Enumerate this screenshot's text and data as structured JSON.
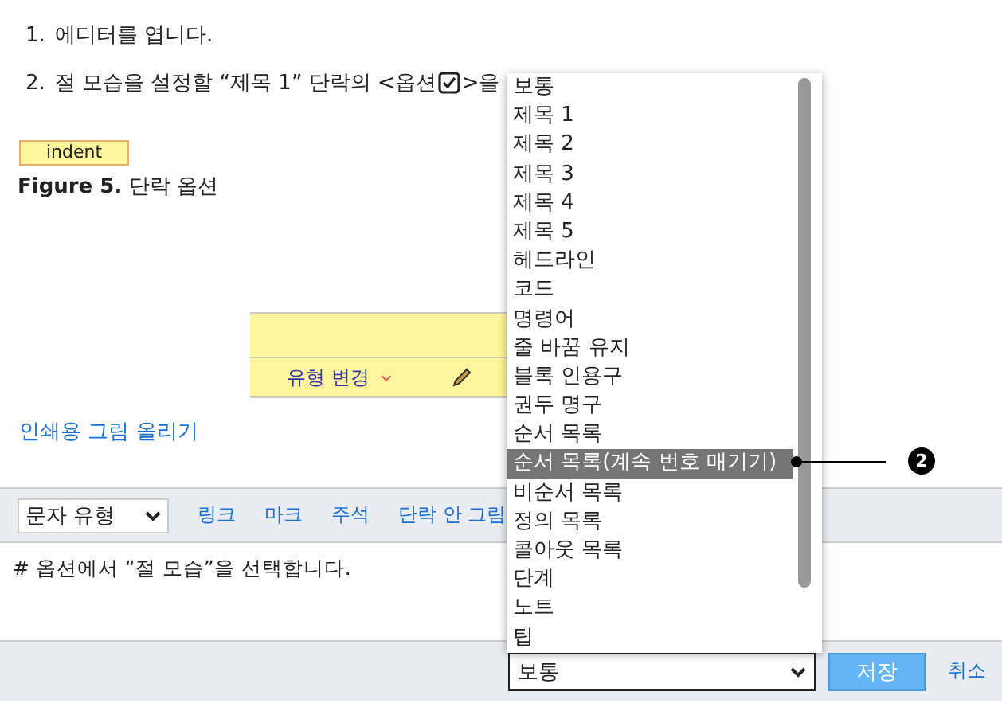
{
  "steps": [
    {
      "number": "1.",
      "text": "에디터를 엽니다."
    },
    {
      "number": "2.",
      "text": "절 모습을 설정할 “제목 1” 단락의 <옵션",
      "after_icon": ">을"
    }
  ],
  "tag": "indent",
  "figure_caption": "**Figure 5.** 단락 옵션",
  "card": {
    "change_type": "유형 변경"
  },
  "upload_link": "인쇄용 그림 올리기",
  "editor": {
    "style_select": "문자 유형",
    "toolbar_links": [
      "링크",
      "마크",
      "주석",
      "단락 안 그림"
    ],
    "text": "# 옵션에서 “절 모습”을 선택합니다.",
    "paragraph_select": "보통",
    "save": "저장",
    "cancel": "취소"
  },
  "dropdown": [
    {
      "label": "보통",
      "selected": false
    },
    {
      "label": "제목 1",
      "selected": false
    },
    {
      "label": "제목 2",
      "selected": false
    },
    {
      "label": "제목 3",
      "selected": false
    },
    {
      "label": "제목 4",
      "selected": false
    },
    {
      "label": "제목 5",
      "selected": false
    },
    {
      "label": "헤드라인",
      "selected": false
    },
    {
      "label": "코드",
      "selected": false
    },
    {
      "label": "명령어",
      "selected": false
    },
    {
      "label": "줄 바꿈 유지",
      "selected": false
    },
    {
      "label": "블록 인용구",
      "selected": false
    },
    {
      "label": "권두 명구",
      "selected": false
    },
    {
      "label": "순서 목록",
      "selected": false
    },
    {
      "label": "순서 목록(계속 번호 매기기)",
      "selected": true
    },
    {
      "label": "비순서 목록",
      "selected": false
    },
    {
      "label": "정의 목록",
      "selected": false
    },
    {
      "label": "콜아웃 목록",
      "selected": false
    },
    {
      "label": "단계",
      "selected": false
    },
    {
      "label": "노트",
      "selected": false
    },
    {
      "label": "팁",
      "selected": false
    }
  ],
  "callout": "2"
}
